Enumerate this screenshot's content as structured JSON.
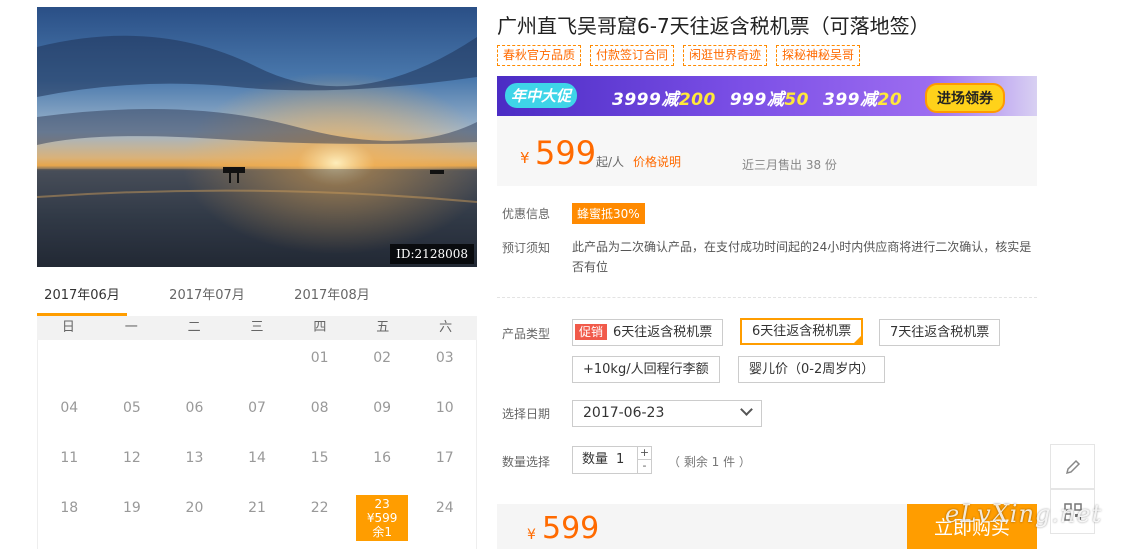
{
  "photo": {
    "id_label": "ID:2128008"
  },
  "calendar": {
    "months": [
      "2017年06月",
      "2017年07月",
      "2017年08月"
    ],
    "weekdays": [
      "日",
      "一",
      "二",
      "三",
      "四",
      "五",
      "六"
    ],
    "rows": [
      [
        "",
        "",
        "",
        "",
        "01",
        "02",
        "03"
      ],
      [
        "04",
        "05",
        "06",
        "07",
        "08",
        "09",
        "10"
      ],
      [
        "11",
        "12",
        "13",
        "14",
        "15",
        "16",
        "17"
      ],
      [
        "18",
        "19",
        "20",
        "21",
        "22",
        "23",
        "24"
      ]
    ],
    "highlight": {
      "day": "23",
      "price": "¥599",
      "remain": "余1"
    }
  },
  "product": {
    "title": "广州直飞吴哥窟6-7天往返含税机票（可落地签）",
    "tags": [
      "春秋官方品质",
      "付款签订合同",
      "闲逛世界奇迹",
      "探秘神秘吴哥"
    ],
    "banner": {
      "tag": "年中大促",
      "deals": [
        {
          "a": "3999减",
          "b": "200"
        },
        {
          "a": "999减",
          "b": "50"
        },
        {
          "a": "399减",
          "b": "20"
        }
      ],
      "button": "进场领券"
    },
    "price": {
      "currency": "¥",
      "value": "599",
      "unit": "起/人",
      "explain": "价格说明",
      "sold": "近三月售出 38 份"
    },
    "discount": {
      "label": "优惠信息",
      "badge": "蜂蜜抵30%"
    },
    "notice": {
      "label": "预订须知",
      "text": "此产品为二次确认产品，在支付成功时间起的24小时内供应商将进行二次确认，核实是否有位"
    },
    "type": {
      "label": "产品类型",
      "promo_tag": "促销",
      "options": [
        "6天往返含税机票",
        "6天往返含税机票",
        "7天往返含税机票",
        "+10kg/人回程行李额",
        "婴儿价（0-2周岁内）"
      ]
    },
    "date": {
      "label": "选择日期",
      "value": "2017-06-23"
    },
    "quantity": {
      "label": "数量选择",
      "prefix": "数量",
      "value": "1",
      "plus": "+",
      "minus": "-",
      "remain": "（ 剩余 1 件 ）"
    },
    "bottom": {
      "currency": "¥",
      "price": "599",
      "buy": "立即购买"
    }
  },
  "watermark": "eLvXing.net",
  "colors": {
    "accent": "#ff9d00",
    "price": "#ff6a00",
    "promo": "#f15a4a"
  }
}
